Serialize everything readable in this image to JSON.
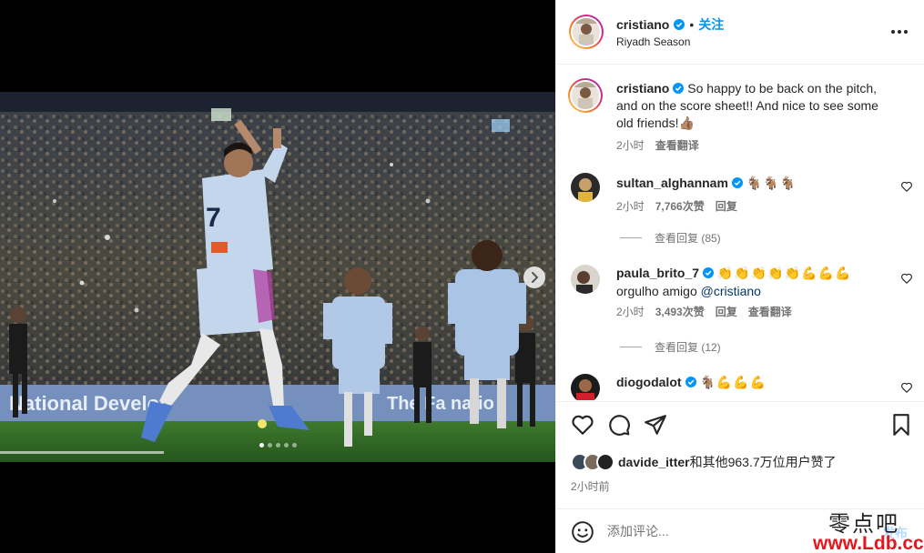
{
  "post": {
    "username": "cristiano",
    "follow_label": "关注",
    "separator": "•",
    "location": "Riyadh Season",
    "more_icon": "more-horizontal-icon"
  },
  "media": {
    "slide_count": 5,
    "active_slide": 1,
    "next_icon": "chevron-right-icon",
    "photo_texts": {
      "jersey_number": "7",
      "banner_text": "National Develop",
      "banner_text_right": "The Fa  natio"
    }
  },
  "caption": {
    "username": "cristiano",
    "text": "So happy to be back on the pitch, and on the score sheet!! And nice to see some old friends!👍🏽",
    "time": "2小时",
    "translate": "查看翻译"
  },
  "comments": [
    {
      "username": "sultan_alghannam",
      "text": "🐐🐐🐐",
      "time": "2小时",
      "likes": "7,766次赞",
      "reply": "回复",
      "view_replies": "查看回复 (85)"
    },
    {
      "username": "paula_brito_7",
      "text": "👏👏👏👏👏💪💪💪",
      "text_line2": "orgulho amigo",
      "mention": "@cristiano",
      "time": "2小时",
      "likes": "3,493次赞",
      "reply": "回复",
      "translate": "查看翻译",
      "view_replies": "查看回复 (12)"
    },
    {
      "username": "diogodalot",
      "text": "🐐💪💪💪"
    }
  ],
  "actions": {
    "like_icon": "heart-icon",
    "comment_icon": "comment-icon",
    "share_icon": "send-icon",
    "save_icon": "bookmark-icon"
  },
  "likes": {
    "user": "davide_itter",
    "rest": "和其他963.7万位用户赞了"
  },
  "time": "2小时前",
  "composer": {
    "placeholder": "添加评论...",
    "post_label": "发布",
    "emoji_icon": "smiley-icon"
  },
  "watermark": {
    "cn": "零点吧",
    "url": "www.Ldb.cc"
  },
  "colors": {
    "accent": "#0095f6",
    "verified": "#0095f6",
    "pitch": "#2f6b25"
  }
}
